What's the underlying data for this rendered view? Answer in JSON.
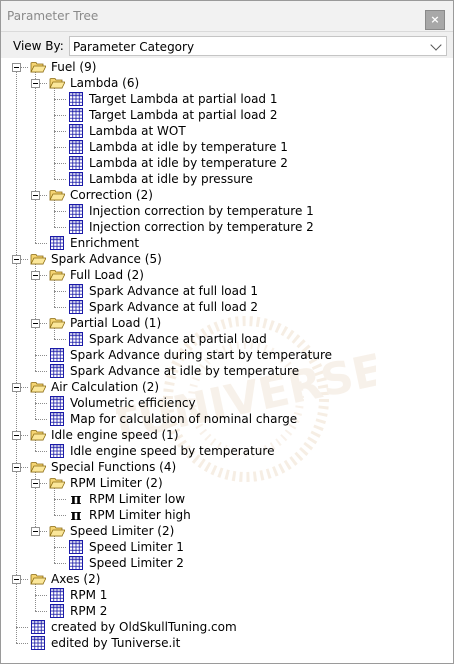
{
  "panel": {
    "title": "Parameter Tree",
    "close_glyph": "×",
    "view_by_label": "View By:",
    "view_by_value": "Parameter Category"
  },
  "watermark_text": "TUNIVERSE",
  "tree": [
    {
      "level": 0,
      "type": "folder",
      "label": "Fuel (9)"
    },
    {
      "level": 1,
      "type": "folder",
      "label": "Lambda (6)"
    },
    {
      "level": 2,
      "type": "table",
      "label": "Target Lambda at partial load 1"
    },
    {
      "level": 2,
      "type": "table",
      "label": "Target Lambda at partial load 2"
    },
    {
      "level": 2,
      "type": "table",
      "label": "Lambda at WOT"
    },
    {
      "level": 2,
      "type": "table",
      "label": "Lambda at idle by temperature 1"
    },
    {
      "level": 2,
      "type": "table",
      "label": "Lambda at idle by temperature 2"
    },
    {
      "level": 2,
      "type": "table",
      "label": "Lambda at idle by pressure"
    },
    {
      "level": 1,
      "type": "folder",
      "label": "Correction (2)"
    },
    {
      "level": 2,
      "type": "table",
      "label": "Injection correction by temperature 1"
    },
    {
      "level": 2,
      "type": "table",
      "label": "Injection correction by temperature 2"
    },
    {
      "level": 1,
      "type": "table",
      "label": "Enrichment"
    },
    {
      "level": 0,
      "type": "folder",
      "label": "Spark Advance (5)"
    },
    {
      "level": 1,
      "type": "folder",
      "label": "Full Load (2)"
    },
    {
      "level": 2,
      "type": "table",
      "label": "Spark Advance at full load 1"
    },
    {
      "level": 2,
      "type": "table",
      "label": "Spark Advance at full load 2"
    },
    {
      "level": 1,
      "type": "folder",
      "label": "Partial Load (1)"
    },
    {
      "level": 2,
      "type": "table",
      "label": "Spark Advance at partial load"
    },
    {
      "level": 1,
      "type": "table",
      "label": "Spark Advance during start by temperature"
    },
    {
      "level": 1,
      "type": "table",
      "label": "Spark Advance at idle by temperature"
    },
    {
      "level": 0,
      "type": "folder",
      "label": "Air Calculation (2)"
    },
    {
      "level": 1,
      "type": "table",
      "label": "Volumetric efficiency"
    },
    {
      "level": 1,
      "type": "table",
      "label": "Map for calculation of nominal charge"
    },
    {
      "level": 0,
      "type": "folder",
      "label": "Idle engine speed (1)"
    },
    {
      "level": 1,
      "type": "table",
      "label": "Idle engine speed by temperature"
    },
    {
      "level": 0,
      "type": "folder",
      "label": "Special Functions (4)"
    },
    {
      "level": 1,
      "type": "folder",
      "label": "RPM Limiter (2)"
    },
    {
      "level": 2,
      "type": "pi",
      "label": "RPM Limiter low"
    },
    {
      "level": 2,
      "type": "pi",
      "label": "RPM Limiter high"
    },
    {
      "level": 1,
      "type": "folder",
      "label": "Speed Limiter (2)"
    },
    {
      "level": 2,
      "type": "table",
      "label": "Speed Limiter 1"
    },
    {
      "level": 2,
      "type": "table",
      "label": "Speed Limiter 2"
    },
    {
      "level": 0,
      "type": "folder",
      "label": "Axes (2)"
    },
    {
      "level": 1,
      "type": "table",
      "label": "RPM 1"
    },
    {
      "level": 1,
      "type": "table",
      "label": "RPM 2"
    },
    {
      "level": 0,
      "type": "table",
      "label": "created by OldSkullTuning.com"
    },
    {
      "level": 0,
      "type": "table",
      "label": "edited by Tuniverse.it"
    }
  ]
}
